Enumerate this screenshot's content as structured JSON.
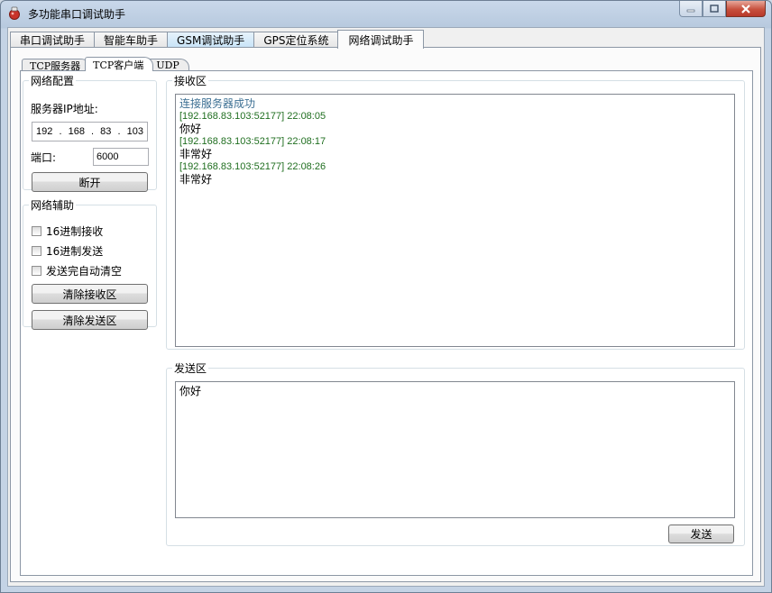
{
  "window": {
    "title": "多功能串口调试助手"
  },
  "main_tabs": [
    {
      "label": "串口调试助手",
      "active": false
    },
    {
      "label": "智能车助手",
      "active": false
    },
    {
      "label": "GSM调试助手",
      "active": false
    },
    {
      "label": "GPS定位系统",
      "active": false
    },
    {
      "label": "网络调试助手",
      "active": true
    }
  ],
  "sub_tabs": [
    {
      "label": "TCP服务器",
      "active": false
    },
    {
      "label": "TCP客户端",
      "active": true
    },
    {
      "label": "UDP",
      "active": false
    }
  ],
  "network_config": {
    "legend": "网络配置",
    "ip_label": "服务器IP地址:",
    "ip_octets": [
      "192",
      "168",
      "83",
      "103"
    ],
    "port_label": "端口:",
    "port_value": "6000",
    "disconnect_label": "断开"
  },
  "network_aux": {
    "legend": "网络辅助",
    "hex_receive": {
      "label": "16进制接收",
      "checked": false
    },
    "hex_send": {
      "label": "16进制发送",
      "checked": false
    },
    "auto_clear": {
      "label": "发送完自动清空",
      "checked": false
    },
    "clear_receive_label": "清除接收区",
    "clear_send_label": "清除发送区"
  },
  "receive": {
    "legend": "接收区",
    "lines": [
      {
        "type": "status",
        "text": "连接服务器成功"
      },
      {
        "type": "meta",
        "text": "[192.168.83.103:52177] 22:08:05"
      },
      {
        "type": "msg",
        "text": "你好"
      },
      {
        "type": "meta",
        "text": "[192.168.83.103:52177] 22:08:17"
      },
      {
        "type": "msg",
        "text": "非常好"
      },
      {
        "type": "meta",
        "text": "[192.168.83.103:52177] 22:08:26"
      },
      {
        "type": "msg",
        "text": "非常好"
      }
    ]
  },
  "send": {
    "legend": "发送区",
    "text": "你好",
    "send_label": "发送"
  },
  "colors": {
    "status_text": "#3c6f93",
    "meta_text": "#1f6e1f",
    "close_button": "#c7503d"
  },
  "icons": {
    "app": "app-icon",
    "minimize": "minimize-icon",
    "maximize": "maximize-icon",
    "close": "close-icon"
  }
}
